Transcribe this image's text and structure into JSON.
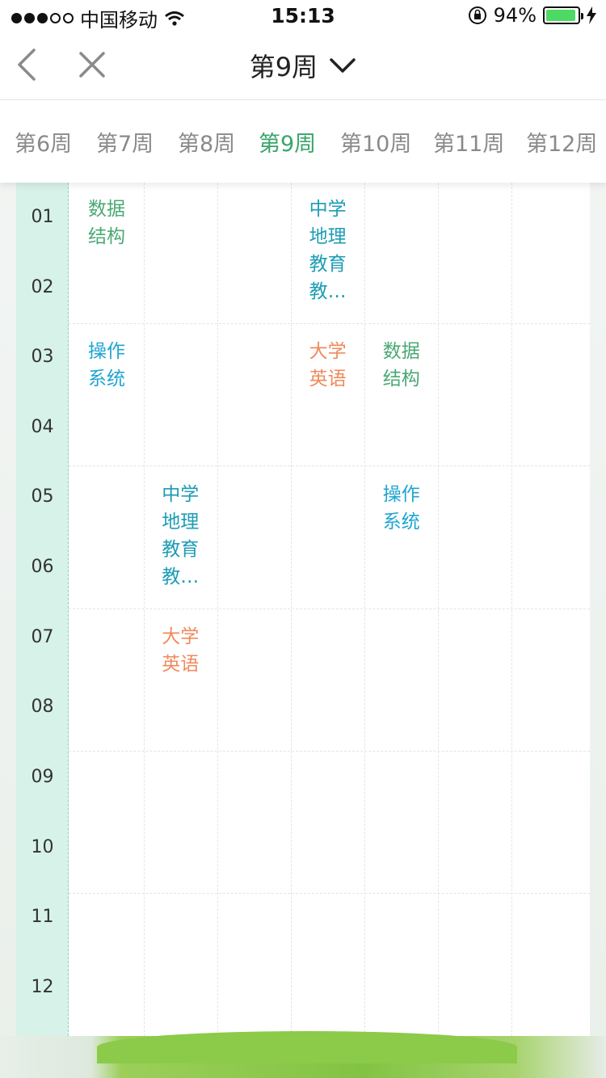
{
  "status_bar": {
    "carrier": "中国移动",
    "time": "15:13",
    "battery_percent": "94%",
    "battery_level": 0.94,
    "signal_bars": 3,
    "signal_total": 5
  },
  "nav": {
    "title": "第9周",
    "back_icon": "chevron-left-icon",
    "close_icon": "close-icon",
    "dropdown_icon": "chevron-down-icon"
  },
  "weeks": [
    "第6周",
    "第7周",
    "第8周",
    "第9周",
    "第10周",
    "第11周",
    "第12周"
  ],
  "active_week": "第9周",
  "periods": [
    "01",
    "02",
    "03",
    "04",
    "05",
    "06",
    "07",
    "08",
    "09",
    "10",
    "11",
    "12"
  ],
  "courses": [
    {
      "name": "数据\n结构",
      "day": 1,
      "period_start": 1,
      "color": "#4aa874"
    },
    {
      "name": "中学\n地理\n教育\n教…",
      "day": 4,
      "period_start": 1,
      "color": "#1d9db4"
    },
    {
      "name": "操作\n系统",
      "day": 1,
      "period_start": 3,
      "color": "#1fa5d1"
    },
    {
      "name": "大学\n英语",
      "day": 4,
      "period_start": 3,
      "color": "#f08a5d"
    },
    {
      "name": "数据\n结构",
      "day": 5,
      "period_start": 3,
      "color": "#4aa874"
    },
    {
      "name": "中学\n地理\n教育\n教…",
      "day": 2,
      "period_start": 5,
      "color": "#1d9db4"
    },
    {
      "name": "操作\n系统",
      "day": 5,
      "period_start": 5,
      "color": "#1fa5d1"
    },
    {
      "name": "大学\n英语",
      "day": 2,
      "period_start": 7,
      "color": "#f08a5d"
    }
  ],
  "colors": {
    "accent_green": "#3aa46b",
    "rail": "#d7f2e8"
  }
}
